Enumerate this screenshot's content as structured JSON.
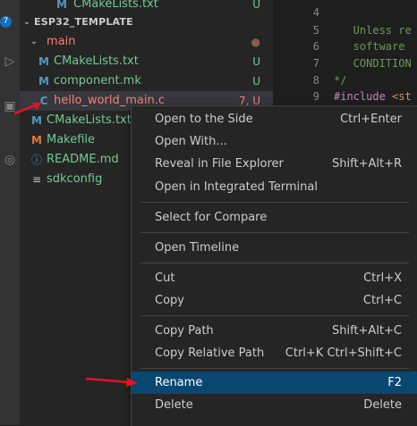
{
  "activity_bar": {
    "badge_count": "7"
  },
  "explorer": {
    "rows": [
      {
        "name": "CMakeLists.txt",
        "icon": "M",
        "status": "U"
      },
      {
        "name": "ESP32_TEMPLATE"
      },
      {
        "name": "main"
      },
      {
        "name": "CMakeLists.txt",
        "icon": "M",
        "status": "U"
      },
      {
        "name": "component.mk",
        "icon": "M",
        "status": "U"
      },
      {
        "name": "hello_world_main.c",
        "icon": "C",
        "status": "7, U"
      },
      {
        "name": "CMakeLists.txt",
        "icon": "M"
      },
      {
        "name": "Makefile",
        "icon": "M"
      },
      {
        "name": "README.md",
        "icon": "ⓘ"
      },
      {
        "name": "sdkconfig",
        "icon": "≡"
      }
    ]
  },
  "editor": {
    "lines": [
      {
        "num": "4",
        "text": ""
      },
      {
        "num": "5",
        "text": "   Unless re"
      },
      {
        "num": "6",
        "text": "   software"
      },
      {
        "num": "7",
        "text": "   CONDITION"
      },
      {
        "num": "8",
        "text": "*/"
      },
      {
        "num": "9",
        "text_directive": "#include",
        "text_rest": " <st"
      }
    ]
  },
  "context_menu": {
    "items": [
      {
        "label": "Open to the Side",
        "shortcut": "Ctrl+Enter"
      },
      {
        "label": "Open With...",
        "shortcut": ""
      },
      {
        "label": "Reveal in File Explorer",
        "shortcut": "Shift+Alt+R"
      },
      {
        "label": "Open in Integrated Terminal",
        "shortcut": ""
      },
      {
        "label": "Select for Compare",
        "shortcut": ""
      },
      {
        "label": "Open Timeline",
        "shortcut": ""
      },
      {
        "label": "Cut",
        "shortcut": "Ctrl+X"
      },
      {
        "label": "Copy",
        "shortcut": "Ctrl+C"
      },
      {
        "label": "Copy Path",
        "shortcut": "Shift+Alt+C"
      },
      {
        "label": "Copy Relative Path",
        "shortcut": "Ctrl+K Ctrl+Shift+C"
      },
      {
        "label": "Rename",
        "shortcut": "F2"
      },
      {
        "label": "Delete",
        "shortcut": "Delete"
      }
    ]
  },
  "colors": {
    "accent_selection": "#094771",
    "git_untracked": "#73c991",
    "git_error": "#f88070",
    "annotation_arrow": "#e81123"
  }
}
